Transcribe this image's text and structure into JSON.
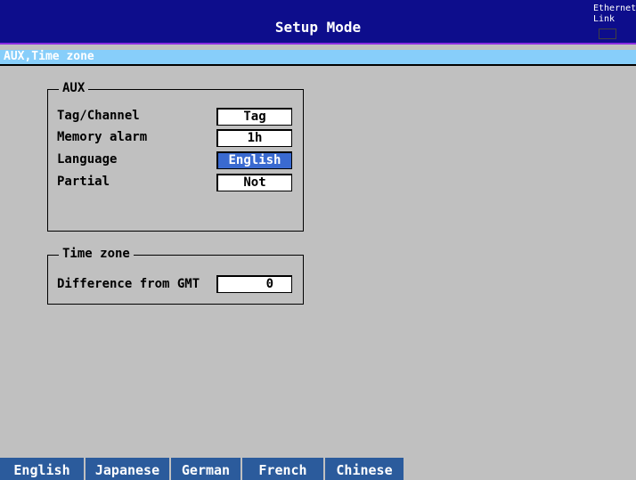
{
  "header": {
    "title": "Setup Mode",
    "ethernet_line1": "Ethernet",
    "ethernet_line2": "Link"
  },
  "section": {
    "title": "AUX,Time zone"
  },
  "aux_group": {
    "title": "AUX",
    "fields": [
      {
        "label": "Tag/Channel",
        "value": "Tag"
      },
      {
        "label": "Memory alarm",
        "value": "1h"
      },
      {
        "label": "Language",
        "value": "English"
      },
      {
        "label": "Partial",
        "value": "Not"
      }
    ]
  },
  "timezone_group": {
    "title": "Time zone",
    "fields": [
      {
        "label": "Difference from GMT",
        "value": "0"
      }
    ]
  },
  "softkeys": [
    "English",
    "Japanese",
    "German",
    "French",
    "Chinese"
  ],
  "colors": {
    "title_bar": "#0d0d8c",
    "section_bar": "#87cefa",
    "background": "#c0c0c0",
    "selected": "#3a6ad0",
    "softkey": "#2b5b9c"
  }
}
